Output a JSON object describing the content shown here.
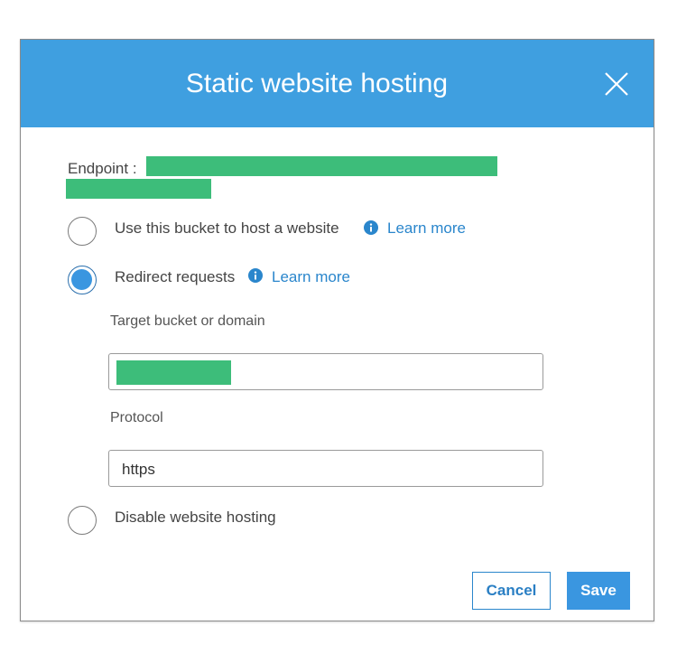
{
  "dialog": {
    "title": "Static website hosting",
    "endpoint_label": "Endpoint :",
    "options": {
      "host": {
        "label": "Use this bucket to host a website",
        "learn_more": "Learn more",
        "selected": false
      },
      "redirect": {
        "label": "Redirect requests",
        "learn_more": "Learn more",
        "selected": true
      },
      "disable": {
        "label": "Disable website hosting",
        "selected": false
      }
    },
    "fields": {
      "target_label": "Target bucket or domain",
      "protocol_label": "Protocol",
      "protocol_value": "https"
    },
    "buttons": {
      "cancel": "Cancel",
      "save": "Save"
    }
  },
  "colors": {
    "header": "#3f9fe0",
    "accent": "#2a86cc",
    "redaction": "#3dbd7a"
  },
  "icons": {
    "close": "close-icon",
    "info": "info-icon"
  }
}
